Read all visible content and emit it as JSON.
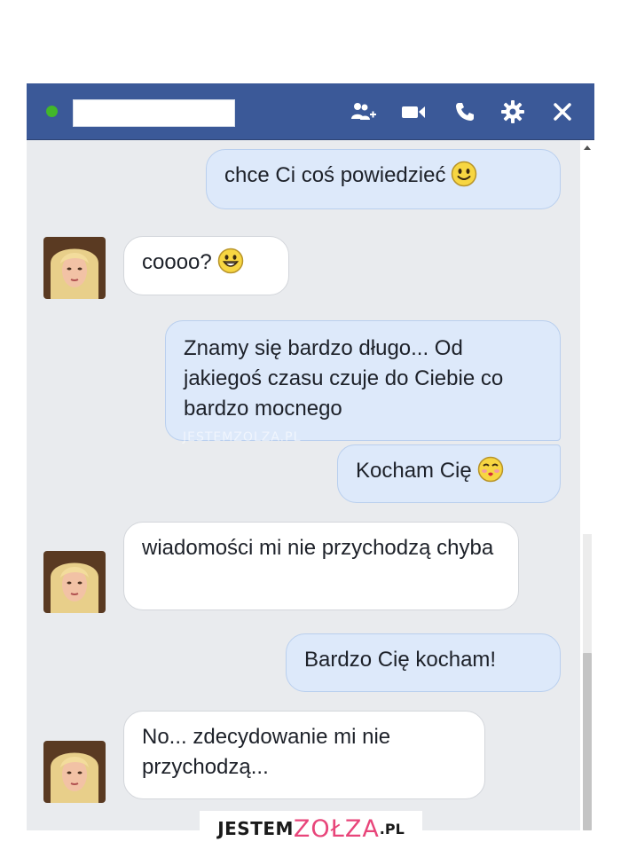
{
  "header": {
    "status": "online",
    "status_color": "#42b72a",
    "bar_color": "#3b5998",
    "icons": [
      "add-friend-icon",
      "video-call-icon",
      "phone-icon",
      "gear-icon",
      "close-icon"
    ]
  },
  "messages": [
    {
      "direction": "sent",
      "text": "chce Ci coś powiedzieć",
      "emoji": "smile-emoji"
    },
    {
      "direction": "received",
      "text": "coooo?",
      "emoji": "grin-emoji"
    },
    {
      "direction": "sent",
      "text": "Znamy się bardzo długo... Od jakiegoś czasu czuje do Ciebie co bardzo mocnego",
      "emoji": ""
    },
    {
      "direction": "sent",
      "text": "Kocham Cię",
      "emoji": "kiss-emoji"
    },
    {
      "direction": "received",
      "text": "wiadomości mi nie przychodzą chyba",
      "emoji": ""
    },
    {
      "direction": "sent",
      "text": "Bardzo Cię kocham!",
      "emoji": ""
    },
    {
      "direction": "received",
      "text": "No... zdecydowanie mi nie przychodzą...",
      "emoji": ""
    }
  ],
  "watermark": {
    "inline": "JESTEMZOLZA.PL",
    "brand_left": "JESTEM",
    "brand_mid": "ZOŁZA",
    "brand_right": ".PL"
  }
}
